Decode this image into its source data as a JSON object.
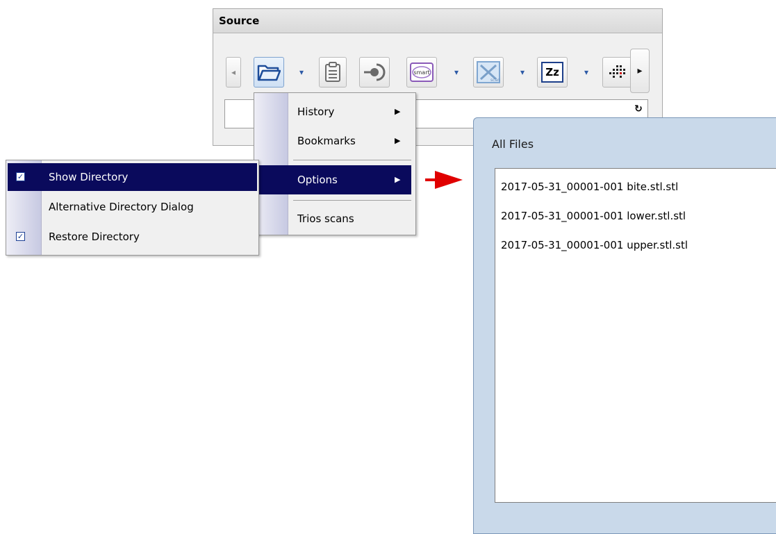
{
  "source_panel": {
    "title": "Source",
    "toolbar": {
      "scroll_left_icon": "◂",
      "scroll_right_icon": "▸",
      "smart_label": "smart",
      "scan_label": "scan",
      "sleep_label": "Zz",
      "dropdown_icon": "▾"
    },
    "refresh_icon": "↻"
  },
  "main_menu": {
    "items": [
      {
        "label": "History",
        "has_submenu": true
      },
      {
        "label": "Bookmarks",
        "has_submenu": true
      },
      {
        "label": "Options",
        "has_submenu": true,
        "active": true
      },
      {
        "label": "Trios scans",
        "has_submenu": false
      }
    ],
    "submenu_arrow": "▶"
  },
  "options_menu": {
    "items": [
      {
        "label": "Show Directory",
        "checked": true,
        "active": true
      },
      {
        "label": "Alternative Directory Dialog",
        "checked": false
      },
      {
        "label": "Restore Directory",
        "checked": true
      }
    ],
    "check_glyph": "✓"
  },
  "files_window": {
    "title": "All Files",
    "files": [
      "2017-05-31_00001-001 bite.stl.stl",
      "2017-05-31_00001-001 lower.stl.stl",
      "2017-05-31_00001-001 upper.stl.stl"
    ]
  },
  "colors": {
    "menu_highlight": "#0a0a5c",
    "annotation_arrow": "#e00000",
    "toolbar_icon_blue": "#2d5aa6"
  }
}
